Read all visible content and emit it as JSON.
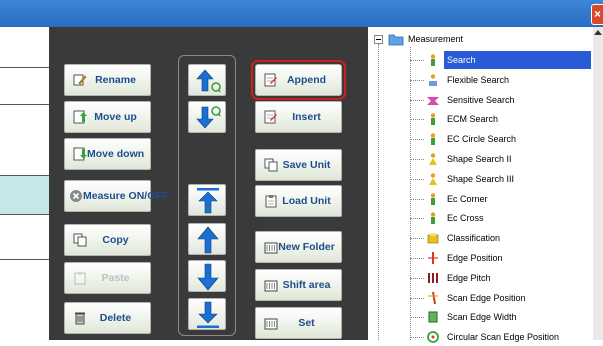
{
  "window": {
    "close_symbol": "×"
  },
  "buttons": {
    "rename": "Rename",
    "move_up": "Move up",
    "move_down": "Move down",
    "measure_on_off": "Measure ON/OFF",
    "copy": "Copy",
    "paste": "Paste",
    "delete": "Delete",
    "append": "Append",
    "insert": "Insert",
    "save_unit": "Save Unit",
    "load_unit": "Load Unit",
    "new_folder": "New Folder",
    "shift_area": "Shift area",
    "set": "Set"
  },
  "tree": {
    "root": "Measurement",
    "selected_index": 0,
    "items": [
      {
        "label": "Search",
        "icon": "search-person-icon"
      },
      {
        "label": "Flexible Search",
        "icon": "flexible-search-icon"
      },
      {
        "label": "Sensitive Search",
        "icon": "sensitive-search-icon"
      },
      {
        "label": "ECM Search",
        "icon": "ecm-search-icon"
      },
      {
        "label": "EC Circle Search",
        "icon": "ec-circle-search-icon"
      },
      {
        "label": "Shape Search II",
        "icon": "shape-search-icon"
      },
      {
        "label": "Shape Search III",
        "icon": "shape-search-icon"
      },
      {
        "label": "Ec Corner",
        "icon": "ec-corner-icon"
      },
      {
        "label": "Ec Cross",
        "icon": "ec-cross-icon"
      },
      {
        "label": "Classification",
        "icon": "classification-icon"
      },
      {
        "label": "Edge Position",
        "icon": "edge-position-icon"
      },
      {
        "label": "Edge Pitch",
        "icon": "edge-pitch-icon"
      },
      {
        "label": "Scan Edge Position",
        "icon": "scan-edge-position-icon"
      },
      {
        "label": "Scan Edge Width",
        "icon": "scan-edge-width-icon"
      },
      {
        "label": "Circular Scan Edge Position",
        "icon": "circular-scan-icon"
      }
    ]
  },
  "colors": {
    "titlebar": "#2a6cc2",
    "panel": "#3a3a3a",
    "selection": "#2a5bd6",
    "accent_text": "#1e4e8c",
    "highlight_outline": "#d01e1e"
  }
}
